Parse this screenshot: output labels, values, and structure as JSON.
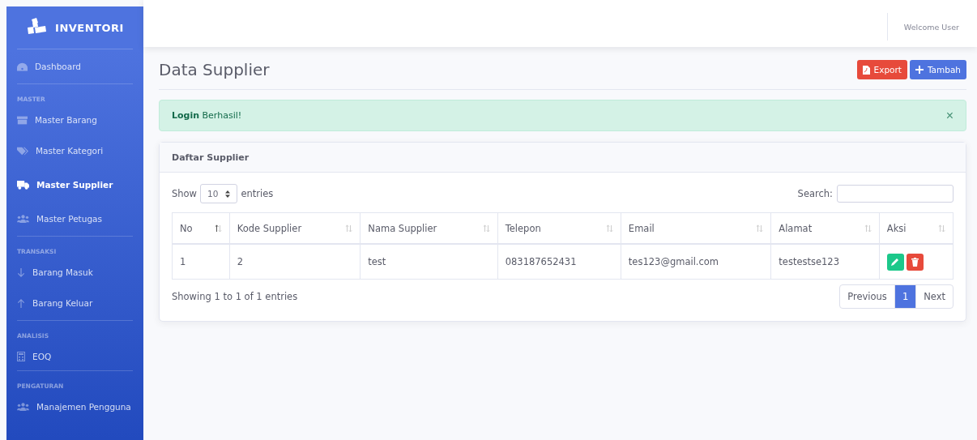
{
  "brand": {
    "title": "INVENTORI"
  },
  "sidebar": {
    "sections": [
      {
        "items": [
          {
            "label": "Dashboard",
            "selected": false
          }
        ]
      },
      {
        "heading": "MASTER",
        "items": [
          {
            "label": "Master Barang",
            "selected": false
          },
          {
            "label": "Master Kategori",
            "selected": false
          },
          {
            "label": "Master Supplier",
            "selected": true
          },
          {
            "label": "Master Petugas",
            "selected": false
          }
        ]
      },
      {
        "heading": "TRANSAKSI",
        "items": [
          {
            "label": "Barang Masuk",
            "selected": false
          },
          {
            "label": "Barang Keluar",
            "selected": false
          }
        ]
      },
      {
        "heading": "ANALISIS",
        "items": [
          {
            "label": "EOQ",
            "selected": false
          }
        ]
      },
      {
        "heading": "PENGATURAN",
        "items": [
          {
            "label": "Manajemen Pengguna",
            "selected": false
          }
        ]
      }
    ]
  },
  "topbar": {
    "user": "Welcome User"
  },
  "page": {
    "title": "Data Supplier",
    "buttons": [
      {
        "label": "Export",
        "kind": "export"
      },
      {
        "label": "Tambah",
        "kind": "add"
      }
    ]
  },
  "alert": {
    "bold": "Login",
    "text": "Berhasil!",
    "close": "×"
  },
  "card": {
    "title": "Daftar Supplier",
    "length_label_before": "Show",
    "length_value": "10",
    "length_label_after": "entries",
    "search_label": "Search:",
    "columns": [
      {
        "label": "No",
        "sorted": true
      },
      {
        "label": "Kode Supplier",
        "sorted": false
      },
      {
        "label": "Nama Supplier",
        "sorted": false
      },
      {
        "label": "Telepon",
        "sorted": false
      },
      {
        "label": "Email",
        "sorted": false
      },
      {
        "label": "Alamat",
        "sorted": false
      },
      {
        "label": "Aksi",
        "sorted": false
      }
    ],
    "rows": [
      {
        "cells": [
          "1",
          "2",
          "test",
          "083187652431",
          "tes123@gmail.com",
          "testestse123"
        ]
      }
    ],
    "info": "Showing 1 to 1 of 1 entries",
    "pagination": [
      {
        "label": "Previous",
        "selected": false
      },
      {
        "label": "1",
        "selected": true
      },
      {
        "label": "Next",
        "selected": false
      }
    ]
  }
}
